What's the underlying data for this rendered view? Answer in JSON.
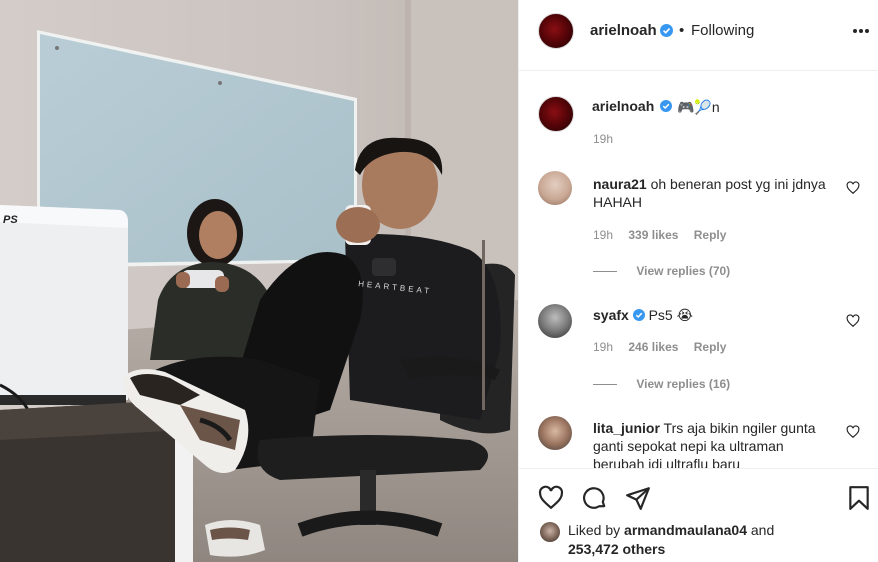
{
  "post": {
    "author": "arielnoah",
    "follow_label": "Following",
    "caption_emoji": "🎮🎾n",
    "caption_time": "19h",
    "likes_prefix": "Liked by",
    "liked_by_user": "armandmaulana04",
    "likes_and": "and",
    "likes_count": "253,472 others"
  },
  "comments": [
    {
      "user": "naura21",
      "text": "oh beneran post yg ini jdnya HAHAH",
      "time": "19h",
      "likes": "339 likes",
      "reply": "Reply",
      "view_replies": "View replies (70)"
    },
    {
      "user": "syafx",
      "text": "Ps5 😭",
      "time": "19h",
      "likes": "246 likes",
      "reply": "Reply",
      "view_replies": "View replies (16)"
    },
    {
      "user": "lita_junior",
      "text": "Trs aja bikin ngiler gunta ganti sepokat nepi ka ultraman berubah jdi ultraflu baru"
    }
  ],
  "photo": {
    "console_logo": "PS",
    "shirt_text": "HEARTBEAT"
  },
  "icons": {
    "more": "more-options-icon",
    "like": "heart-icon",
    "comment": "comment-icon",
    "share": "share-icon",
    "save": "bookmark-icon",
    "verified": "verified-badge-icon"
  },
  "colors": {
    "verified": "#3897f0",
    "text": "#262626",
    "muted": "#8e8e8e"
  }
}
